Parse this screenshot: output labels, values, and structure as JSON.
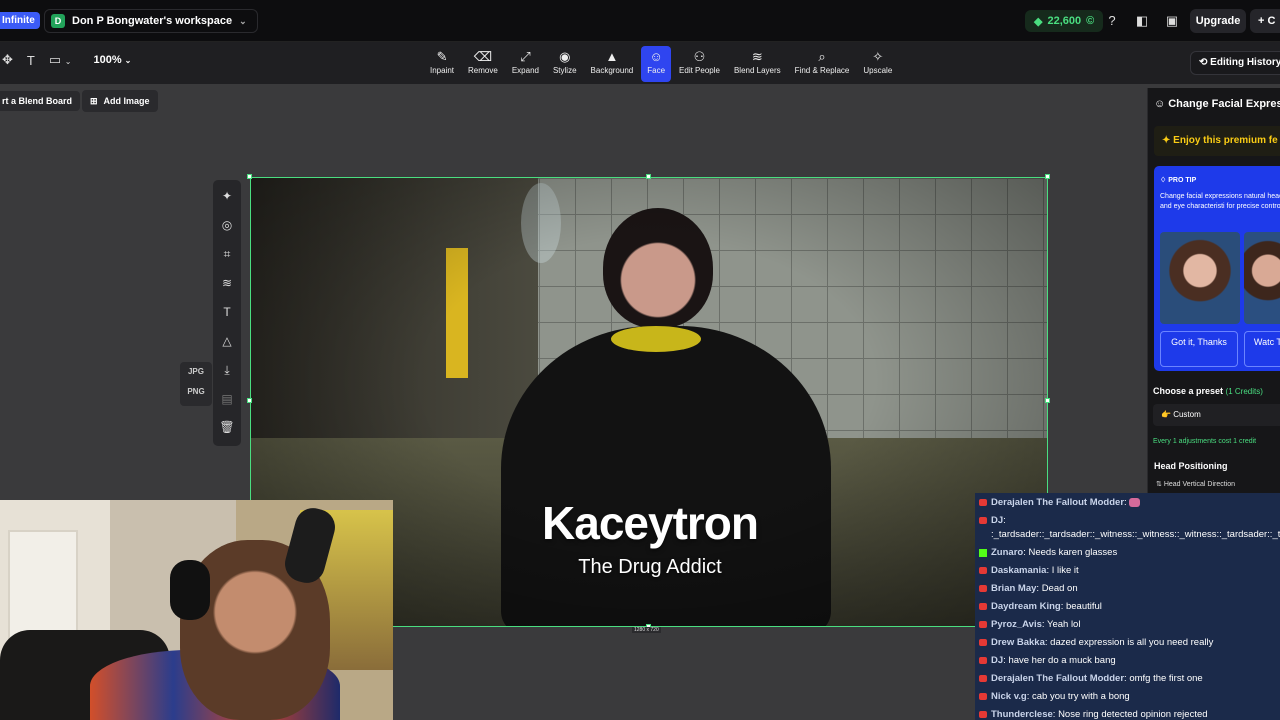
{
  "topbar": {
    "plan_badge": "Infinite",
    "workspace_initial": "D",
    "workspace_name": "Don P Bongwater's workspace",
    "credits": "22,600",
    "upgrade_label": "Upgrade",
    "create_label": "+ C"
  },
  "toolbar": {
    "zoom": "100%",
    "tools": [
      {
        "label": "Inpaint",
        "icon": "✎"
      },
      {
        "label": "Remove",
        "icon": "⌫"
      },
      {
        "label": "Expand",
        "icon": "⤢"
      },
      {
        "label": "Stylize",
        "icon": "◉"
      },
      {
        "label": "Background",
        "icon": "▲"
      },
      {
        "label": "Face",
        "icon": "☺"
      },
      {
        "label": "Edit People",
        "icon": "⚇"
      },
      {
        "label": "Blend Layers",
        "icon": "≋"
      },
      {
        "label": "Find & Replace",
        "icon": "⌕"
      },
      {
        "label": "Upscale",
        "icon": "✧"
      }
    ],
    "active_tool": "Face",
    "editing_history": "Editing History"
  },
  "canvas": {
    "blend_board_label": "rt a Blend Board",
    "add_image_label": "Add Image",
    "export_formats": [
      "JPG",
      "PNG"
    ],
    "image_title": "Kaceytron",
    "image_subtitle": "The Drug Addict",
    "image_dims": "1280 x 720"
  },
  "panel": {
    "title": "Change Facial Expressio",
    "premium_text": "Enjoy this premium fe",
    "protip_label": "PRO TIP",
    "protip_text": "Change facial expressions natural head, mouth and eye characteristi for precise control.",
    "got_it_label": "Got it, Thanks",
    "watch_label": "Watc Tuto",
    "preset_label": "Choose a preset",
    "preset_credits": "(1 Credits)",
    "preset_value": "Custom",
    "adjust_note": "Every 1 adjustments cost 1 credit",
    "head_positioning": "Head Positioning",
    "head_vertical": "Head Vertical Direction"
  },
  "chat": [
    {
      "user": "Derajalen The Fallout Modder",
      "text": "",
      "emote": true,
      "badge": "yt"
    },
    {
      "user": "DJ",
      "text": ":_tardsader::_tardsader::_witness::_witness::_witness::_tardsader::_tardsader:",
      "badge": "yt"
    },
    {
      "user": "Zunaro",
      "text": "Needs karen glasses",
      "badge": "kick"
    },
    {
      "user": "Daskamania",
      "text": "I like it",
      "badge": "yt"
    },
    {
      "user": "Brian May",
      "text": "Dead on",
      "badge": "yt"
    },
    {
      "user": "Daydream King",
      "text": "beautiful",
      "badge": "yt"
    },
    {
      "user": "Pyroz_Avis",
      "text": "Yeah lol",
      "badge": "yt"
    },
    {
      "user": "Drew Bakka",
      "text": "dazed expression is all you need really",
      "badge": "yt"
    },
    {
      "user": "DJ",
      "text": "have her do a muck bang",
      "badge": "yt"
    },
    {
      "user": "Derajalen The Fallout Modder",
      "text": "omfg the first one",
      "badge": "yt"
    },
    {
      "user": "Nick v.g",
      "text": "cab you try with a bong",
      "badge": "yt"
    },
    {
      "user": "Thunderclese",
      "text": "Nose ring detected opinion rejected",
      "badge": "yt"
    }
  ],
  "colors": {
    "accent": "#2f45f0",
    "selection": "#4ade80",
    "credits": "#4ade80",
    "premium": "#facc15"
  }
}
